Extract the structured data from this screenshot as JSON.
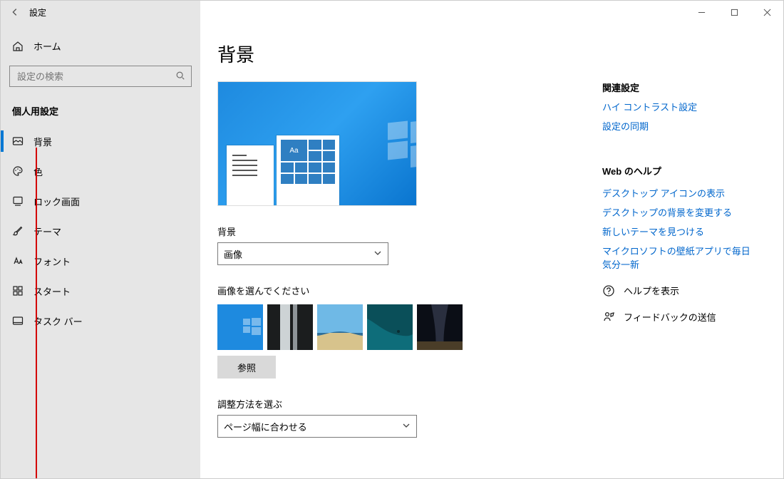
{
  "window": {
    "title": "設定"
  },
  "sidebar": {
    "home": "ホーム",
    "search_placeholder": "設定の検索",
    "section_header": "個人用設定",
    "items": [
      {
        "label": "背景",
        "icon": "image",
        "selected": true
      },
      {
        "label": "色",
        "icon": "palette"
      },
      {
        "label": "ロック画面",
        "icon": "lock-screen"
      },
      {
        "label": "テーマ",
        "icon": "brush"
      },
      {
        "label": "フォント",
        "icon": "font"
      },
      {
        "label": "スタート",
        "icon": "start"
      },
      {
        "label": "タスク バー",
        "icon": "taskbar"
      }
    ]
  },
  "main": {
    "title": "背景",
    "preview_accent_text": "Aa",
    "background_label": "背景",
    "background_select_value": "画像",
    "choose_image_label": "画像を選んでください",
    "browse_label": "参照",
    "fit_label": "調整方法を選ぶ",
    "fit_select_value": "ページ幅に合わせる"
  },
  "right": {
    "related_header": "関連設定",
    "related_links": [
      "ハイ コントラスト設定",
      "設定の同期"
    ],
    "web_help_header": "Web のヘルプ",
    "web_help_links": [
      "デスクトップ アイコンの表示",
      "デスクトップの背景を変更する",
      "新しいテーマを見つける",
      "マイクロソフトの壁紙アプリで毎日気分一新"
    ],
    "support_label": "ヘルプを表示",
    "feedback_label": "フィードバックの送信"
  }
}
